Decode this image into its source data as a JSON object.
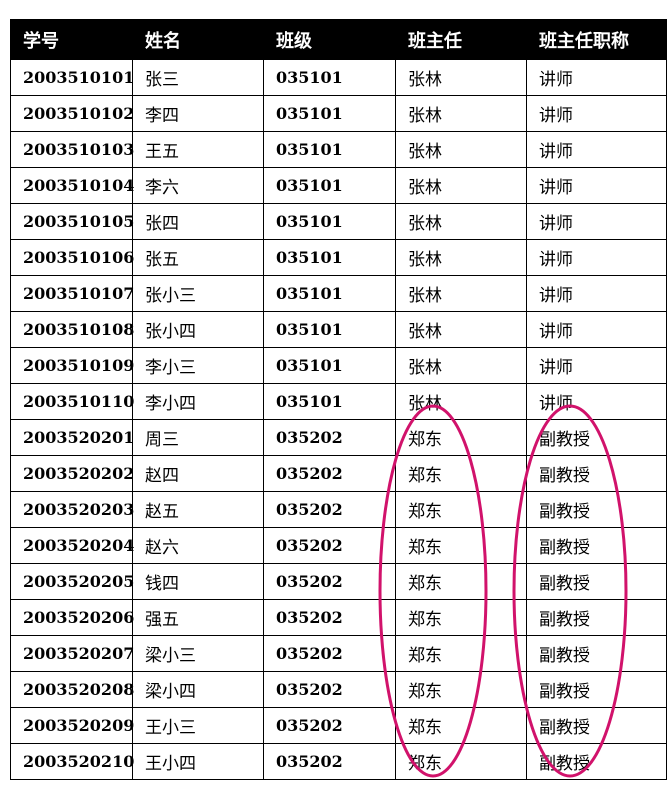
{
  "table": {
    "headers": [
      "学号",
      "姓名",
      "班级",
      "班主任",
      "班主任职称"
    ],
    "rows": [
      [
        "2003510101",
        "张三",
        "035101",
        "张林",
        "讲师"
      ],
      [
        "2003510102",
        "李四",
        "035101",
        "张林",
        "讲师"
      ],
      [
        "2003510103",
        "王五",
        "035101",
        "张林",
        "讲师"
      ],
      [
        "2003510104",
        "李六",
        "035101",
        "张林",
        "讲师"
      ],
      [
        "2003510105",
        "张四",
        "035101",
        "张林",
        "讲师"
      ],
      [
        "2003510106",
        "张五",
        "035101",
        "张林",
        "讲师"
      ],
      [
        "2003510107",
        "张小三",
        "035101",
        "张林",
        "讲师"
      ],
      [
        "2003510108",
        "张小四",
        "035101",
        "张林",
        "讲师"
      ],
      [
        "2003510109",
        "李小三",
        "035101",
        "张林",
        "讲师"
      ],
      [
        "2003510110",
        "李小四",
        "035101",
        "张林",
        "讲师"
      ],
      [
        "2003520201",
        "周三",
        "035202",
        "郑东",
        "副教授"
      ],
      [
        "2003520202",
        "赵四",
        "035202",
        "郑东",
        "副教授"
      ],
      [
        "2003520203",
        "赵五",
        "035202",
        "郑东",
        "副教授"
      ],
      [
        "2003520204",
        "赵六",
        "035202",
        "郑东",
        "副教授"
      ],
      [
        "2003520205",
        "钱四",
        "035202",
        "郑东",
        "副教授"
      ],
      [
        "2003520206",
        "强五",
        "035202",
        "郑东",
        "副教授"
      ],
      [
        "2003520207",
        "梁小三",
        "035202",
        "郑东",
        "副教授"
      ],
      [
        "2003520208",
        "梁小四",
        "035202",
        "郑东",
        "副教授"
      ],
      [
        "2003520209",
        "王小三",
        "035202",
        "郑东",
        "副教授"
      ],
      [
        "2003520210",
        "王小四",
        "035202",
        "郑东",
        "副教授"
      ]
    ]
  },
  "annotation": {
    "color": "#d1126b"
  }
}
